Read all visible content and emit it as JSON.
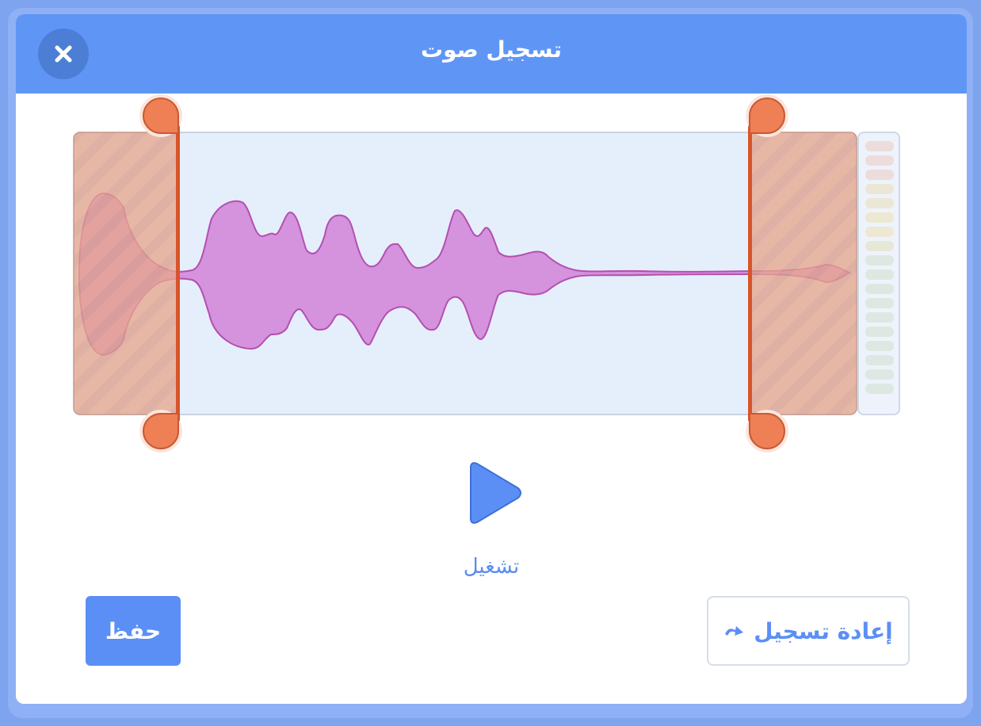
{
  "dialog": {
    "title": "تسجيل صوت",
    "close_icon": "close-icon"
  },
  "playback": {
    "play_label": "تشغيل",
    "play_icon": "play-triangle-icon"
  },
  "footer": {
    "save_label": "حفظ",
    "rerecord_label": "إعادة تسجيل",
    "rerecord_icon": "redo-arrow-icon"
  },
  "colors": {
    "header": "#5f96f6",
    "accent": "#5b8ff5",
    "trim_handle": "#ef7f54",
    "waveform": "#d592dd"
  }
}
